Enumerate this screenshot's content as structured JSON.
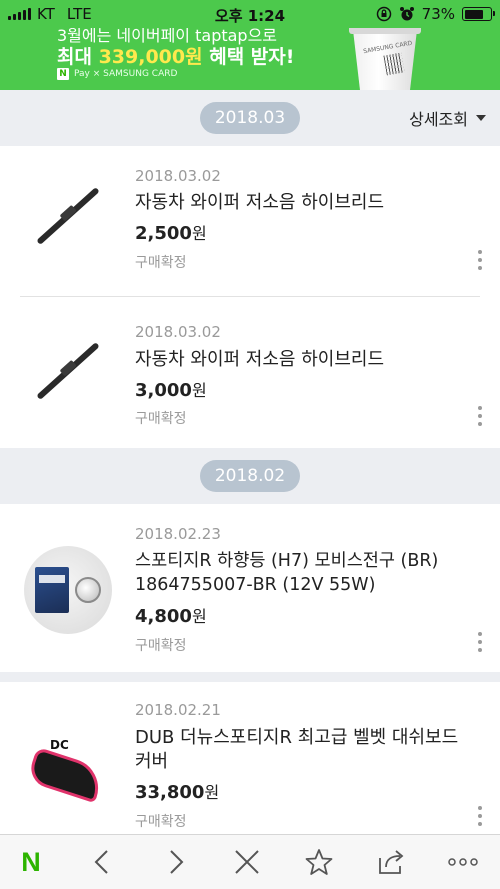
{
  "status_bar": {
    "carrier": "KT",
    "network": "LTE",
    "time": "오후 1:24",
    "battery": "73%",
    "battery_level": 0.73
  },
  "banner": {
    "line1": "3월에는 네이버페이 taptap으로",
    "line2_prefix": "최대 ",
    "line2_amount": "339,000원",
    "line2_suffix": " 혜택 받자!",
    "npay_logo": "N",
    "partner_line": "Pay × SAMSUNG CARD",
    "cup_brand": "SAMSUNG CARD"
  },
  "sections": [
    {
      "month": "2018.03",
      "detail_label": "상세조회",
      "items": [
        {
          "date": "2018.03.02",
          "name": "자동차 와이퍼 저소음 하이브리드",
          "price": "2,500",
          "currency": "원",
          "status": "구매확정",
          "icon": "wiper-thumbnail"
        },
        {
          "date": "2018.03.02",
          "name": "자동차 와이퍼 저소음 하이브리드",
          "price": "3,000",
          "currency": "원",
          "status": "구매확정",
          "icon": "wiper-thumbnail"
        }
      ]
    },
    {
      "month": "2018.02",
      "items": [
        {
          "date": "2018.02.23",
          "name": "스포티지R 하향등 (H7) 모비스전구 (BR) 1864755007-BR (12V 55W)",
          "price": "4,800",
          "currency": "원",
          "status": "구매확정",
          "icon": "bulb-thumbnail"
        },
        {
          "date": "2018.02.21",
          "name": "DUB 더뉴스포티지R 최고급 벨벳 대쉬보드커버",
          "price": "33,800",
          "currency": "원",
          "status": "구매확정",
          "icon": "dashboard-cover-thumbnail",
          "logo_text": "DC"
        }
      ]
    }
  ],
  "toolbar": {
    "home": "N",
    "icons": [
      "naver-home-icon",
      "back-icon",
      "forward-icon",
      "close-icon",
      "bookmark-star-icon",
      "share-icon",
      "more-icon"
    ]
  },
  "colors": {
    "accent_green": "#4cc94c",
    "naver_green": "#2db400",
    "highlight_yellow": "#ffe94d",
    "month_pill": "#b8c4d0"
  }
}
